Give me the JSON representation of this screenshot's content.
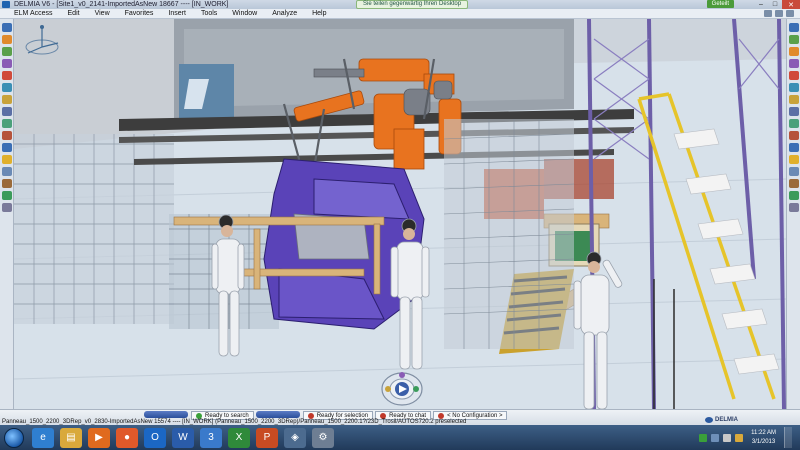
{
  "window": {
    "title": "DELMIA V6 - [Site1_v0_2141-ImportedAsNew 18667 ---- [IN_WORK]",
    "share_notice": "Sie teilen gegenwärtig Ihren Desktop",
    "login_badge": "Geteilt"
  },
  "menu": {
    "items": [
      "ELM Access",
      "Edit",
      "View",
      "Favorites",
      "Insert",
      "Tools",
      "Window",
      "Analyze",
      "Help"
    ]
  },
  "statusbar": {
    "cells": [
      {
        "label": "Ready to search",
        "dot_color": "#3aa03a"
      },
      {
        "label": "Ready for selection",
        "dot_color": "#c0392b"
      },
      {
        "label": "Ready to chat",
        "dot_color": "#c0392b"
      },
      {
        "label": "< No Configuration >",
        "dot_color": "#c0392b"
      }
    ],
    "line2": "Panneau_1500_2200_3DRep_v0_2830-ImportedAsNew 15574 ---- [IN_WORK] (Panneau_1500_2200_3DRep)/Panneau_1500_2200.1?/23D_Trosil/AUTOS720.2 preselected",
    "logo_text": "DELMIA"
  },
  "taskbar": {
    "apps": [
      {
        "name": "ie-icon",
        "color": "#2f7fd0",
        "glyph": "e"
      },
      {
        "name": "explorer-icon",
        "color": "#d9a93b",
        "glyph": "▤"
      },
      {
        "name": "media-player-icon",
        "color": "#e06a1e",
        "glyph": "▶"
      },
      {
        "name": "firefox-icon",
        "color": "#e0592a",
        "glyph": "●"
      },
      {
        "name": "outlook-icon",
        "color": "#1b67c4",
        "glyph": "O"
      },
      {
        "name": "word-icon",
        "color": "#2a5caa",
        "glyph": "W"
      },
      {
        "name": "catia-icon",
        "color": "#3a7acb",
        "glyph": "3"
      },
      {
        "name": "excel-icon",
        "color": "#2f8a3a",
        "glyph": "X"
      },
      {
        "name": "powerpoint-icon",
        "color": "#c84b22",
        "glyph": "P"
      },
      {
        "name": "network-icon",
        "color": "#4c6b8f",
        "glyph": "◈"
      },
      {
        "name": "settings-icon",
        "color": "#6e7e93",
        "glyph": "⚙"
      }
    ],
    "clock_time": "11:22 AM",
    "clock_date": "3/1/2013"
  }
}
